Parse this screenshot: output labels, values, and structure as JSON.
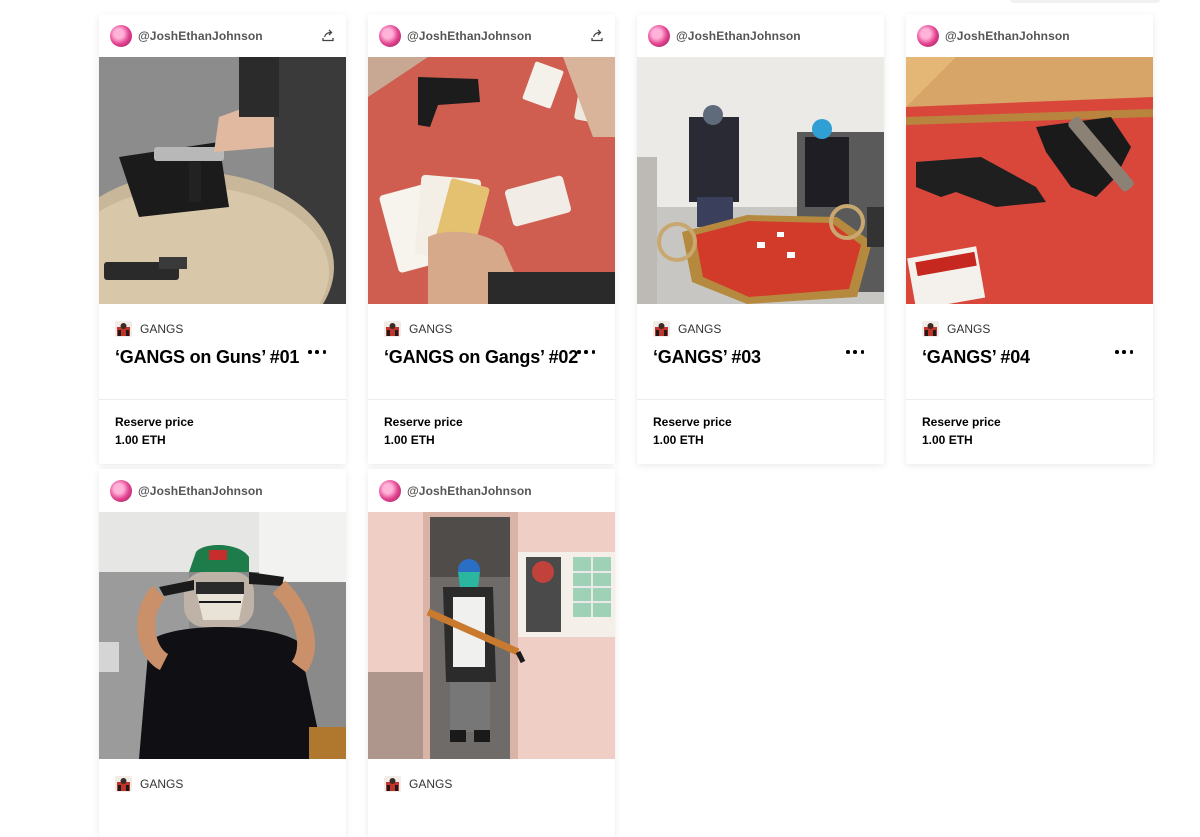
{
  "cards": [
    {
      "username": "@JoshEthanJohnson",
      "image_alt": "hand placing pistol into bag on table, second gun on table",
      "collection": "GANGS",
      "title": "‘GANGS on Guns’ #01",
      "price_label": "Reserve price",
      "price_value": "1.00 ETH"
    },
    {
      "username": "@JoshEthanJohnson",
      "image_alt": "playing cards and pistol on red table",
      "collection": "GANGS",
      "title": "‘GANGS on Gangs’ #02",
      "price_label": "Reserve price",
      "price_value": "1.00 ETH"
    },
    {
      "username": "@JoshEthanJohnson",
      "image_alt": "masked men around octagonal card table",
      "collection": "GANGS",
      "title": "‘GANGS’ #03",
      "price_label": "Reserve price",
      "price_value": "1.00 ETH"
    },
    {
      "username": "@JoshEthanJohnson",
      "image_alt": "two pistols and cigarette pack on red table",
      "collection": "GANGS",
      "title": "‘GANGS’ #04",
      "price_label": "Reserve price",
      "price_value": "1.00 ETH"
    },
    {
      "username": "@JoshEthanJohnson",
      "image_alt": "masked man holding pistols to head",
      "collection": "GANGS"
    },
    {
      "username": "@JoshEthanJohnson",
      "image_alt": "masked men in doorway and window with rifle",
      "collection": "GANGS"
    }
  ],
  "icons": {
    "share": "share-icon",
    "more": "more-options-icon",
    "avatar": "avatar",
    "collection": "collection-icon"
  }
}
